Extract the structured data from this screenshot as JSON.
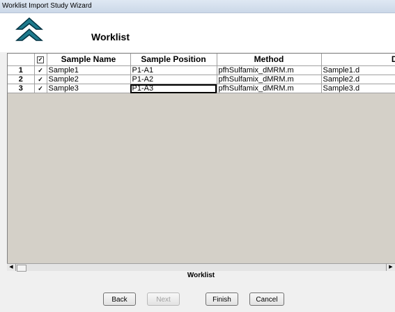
{
  "window": {
    "title": "Worklist Import Study Wizard"
  },
  "header": {
    "title": "Worklist",
    "logo_icon": "double-chevron-up-icon"
  },
  "grid": {
    "columns": [
      "Sample Name",
      "Sample Position",
      "Method",
      "Data F"
    ],
    "header_checkbox": "checked",
    "rows": [
      {
        "num": "1",
        "check": "✓",
        "sample_name": "Sample1",
        "position": "P1-A1",
        "method": "pfhSulfamix_dMRM.m",
        "data_file": "Sample1.d"
      },
      {
        "num": "2",
        "check": "✓",
        "sample_name": "Sample2",
        "position": "P1-A2",
        "method": "pfhSulfamix_dMRM.m",
        "data_file": "Sample2.d"
      },
      {
        "num": "3",
        "check": "✓",
        "sample_name": "Sample3",
        "position": "P1-A3",
        "method": "pfhSulfamix_dMRM.m",
        "data_file": "Sample3.d"
      }
    ],
    "caption": "Worklist"
  },
  "buttons": {
    "back": "Back",
    "next": "Next",
    "finish": "Finish",
    "cancel": "Cancel"
  },
  "colors": {
    "grid_background": "#d4d0c8",
    "logo_teal": "#1f7a8c",
    "logo_dark": "#003040"
  }
}
